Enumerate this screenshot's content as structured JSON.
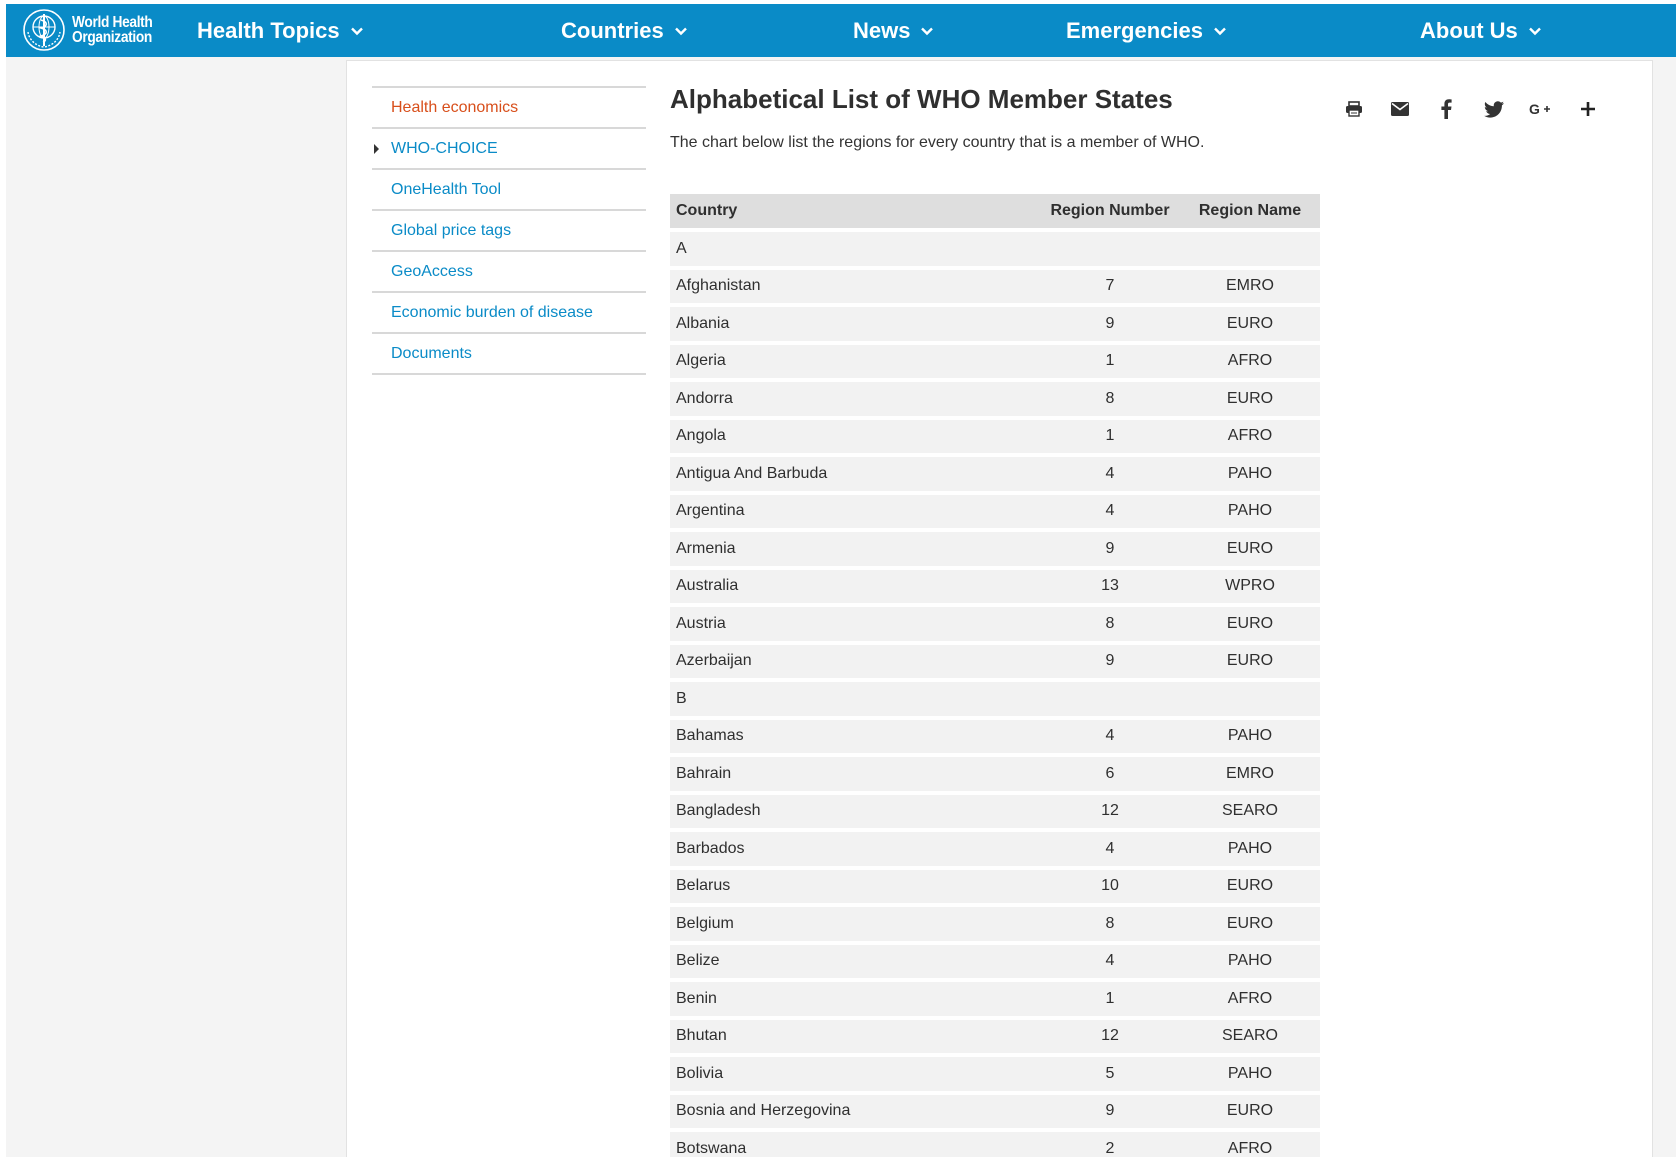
{
  "brand": {
    "logo_line1": "World Health",
    "logo_line2": "Organization"
  },
  "nav": {
    "items": [
      {
        "label": "Health Topics"
      },
      {
        "label": "Countries"
      },
      {
        "label": "News"
      },
      {
        "label": "Emergencies"
      },
      {
        "label": "About Us"
      }
    ]
  },
  "sidebar": {
    "items": [
      {
        "label": "Health economics",
        "active": true
      },
      {
        "label": "WHO-CHOICE",
        "expandable": true
      },
      {
        "label": "OneHealth Tool"
      },
      {
        "label": "Global price tags"
      },
      {
        "label": "GeoAccess"
      },
      {
        "label": "Economic burden of disease"
      },
      {
        "label": "Documents"
      }
    ]
  },
  "main": {
    "title": "Alphabetical List of WHO Member States",
    "description": "The chart below list the regions for every country that is a member of WHO."
  },
  "share": {
    "icons": [
      "print-icon",
      "email-icon",
      "facebook-icon",
      "twitter-icon",
      "google-plus-icon",
      "plus-icon"
    ]
  },
  "table": {
    "headers": {
      "country": "Country",
      "region_number": "Region Number",
      "region_name": "Region Name"
    },
    "rows": [
      {
        "country": "A",
        "region_number": "",
        "region_name": ""
      },
      {
        "country": "Afghanistan",
        "region_number": "7",
        "region_name": "EMRO"
      },
      {
        "country": "Albania",
        "region_number": "9",
        "region_name": "EURO"
      },
      {
        "country": "Algeria",
        "region_number": "1",
        "region_name": "AFRO"
      },
      {
        "country": "Andorra",
        "region_number": "8",
        "region_name": "EURO"
      },
      {
        "country": "Angola",
        "region_number": "1",
        "region_name": "AFRO"
      },
      {
        "country": "Antigua And Barbuda",
        "region_number": "4",
        "region_name": "PAHO"
      },
      {
        "country": "Argentina",
        "region_number": "4",
        "region_name": "PAHO"
      },
      {
        "country": "Armenia",
        "region_number": "9",
        "region_name": "EURO"
      },
      {
        "country": "Australia",
        "region_number": "13",
        "region_name": "WPRO"
      },
      {
        "country": "Austria",
        "region_number": "8",
        "region_name": "EURO"
      },
      {
        "country": "Azerbaijan",
        "region_number": "9",
        "region_name": "EURO"
      },
      {
        "country": "B",
        "region_number": "",
        "region_name": ""
      },
      {
        "country": "Bahamas",
        "region_number": "4",
        "region_name": "PAHO"
      },
      {
        "country": "Bahrain",
        "region_number": "6",
        "region_name": "EMRO"
      },
      {
        "country": "Bangladesh",
        "region_number": "12",
        "region_name": "SEARO"
      },
      {
        "country": "Barbados",
        "region_number": "4",
        "region_name": "PAHO"
      },
      {
        "country": "Belarus",
        "region_number": "10",
        "region_name": "EURO"
      },
      {
        "country": "Belgium",
        "region_number": "8",
        "region_name": "EURO"
      },
      {
        "country": "Belize",
        "region_number": "4",
        "region_name": "PAHO"
      },
      {
        "country": "Benin",
        "region_number": "1",
        "region_name": "AFRO"
      },
      {
        "country": "Bhutan",
        "region_number": "12",
        "region_name": "SEARO"
      },
      {
        "country": "Bolivia",
        "region_number": "5",
        "region_name": "PAHO"
      },
      {
        "country": "Bosnia and Herzegovina",
        "region_number": "9",
        "region_name": "EURO"
      },
      {
        "country": "Botswana",
        "region_number": "2",
        "region_name": "AFRO"
      }
    ]
  },
  "colors": {
    "nav_bg": "#0a8bc7",
    "link": "#0a8bc7",
    "active_link": "#d84f1b",
    "page_bg": "#f4f4f4"
  }
}
